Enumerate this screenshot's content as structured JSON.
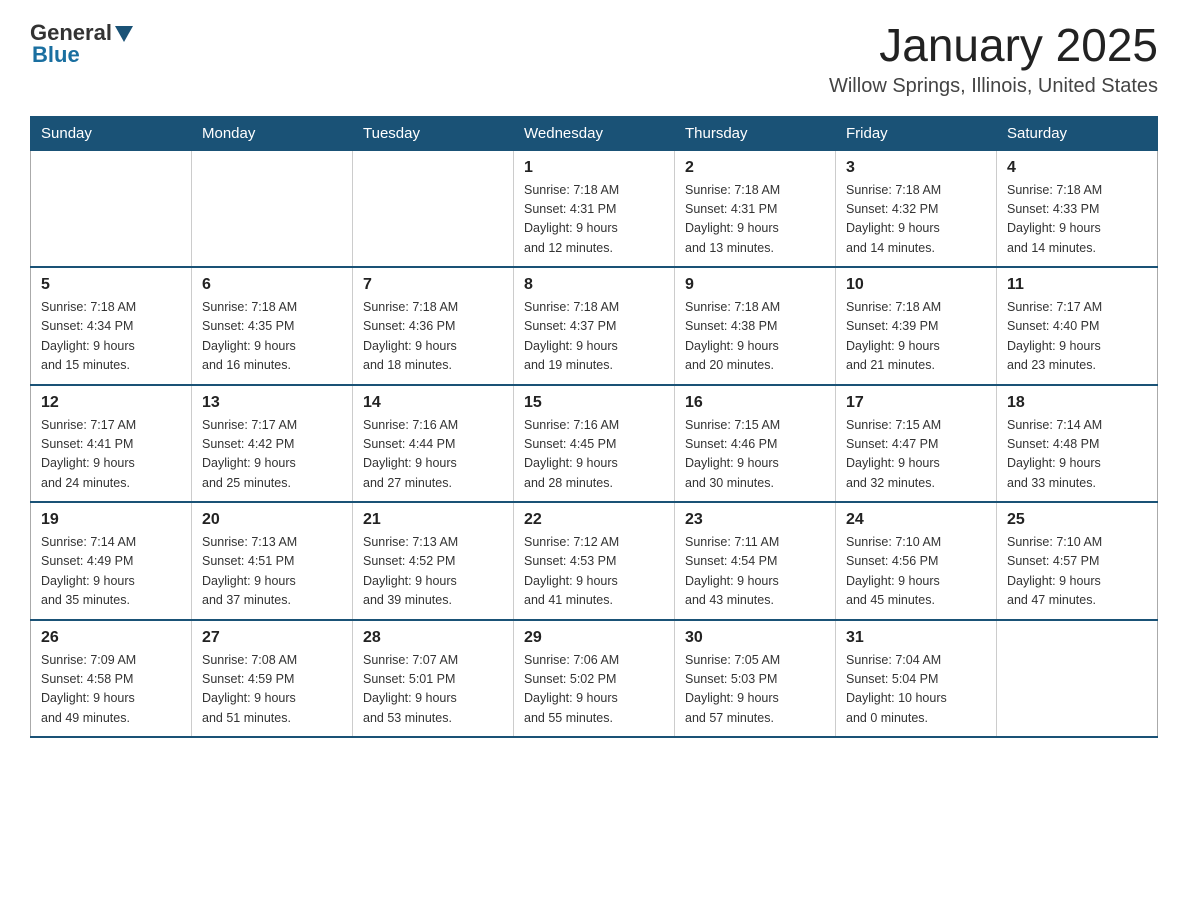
{
  "header": {
    "logo_general": "General",
    "logo_blue": "Blue",
    "title": "January 2025",
    "subtitle": "Willow Springs, Illinois, United States"
  },
  "days_of_week": [
    "Sunday",
    "Monday",
    "Tuesday",
    "Wednesday",
    "Thursday",
    "Friday",
    "Saturday"
  ],
  "weeks": [
    [
      {
        "day": "",
        "info": ""
      },
      {
        "day": "",
        "info": ""
      },
      {
        "day": "",
        "info": ""
      },
      {
        "day": "1",
        "info": "Sunrise: 7:18 AM\nSunset: 4:31 PM\nDaylight: 9 hours\nand 12 minutes."
      },
      {
        "day": "2",
        "info": "Sunrise: 7:18 AM\nSunset: 4:31 PM\nDaylight: 9 hours\nand 13 minutes."
      },
      {
        "day": "3",
        "info": "Sunrise: 7:18 AM\nSunset: 4:32 PM\nDaylight: 9 hours\nand 14 minutes."
      },
      {
        "day": "4",
        "info": "Sunrise: 7:18 AM\nSunset: 4:33 PM\nDaylight: 9 hours\nand 14 minutes."
      }
    ],
    [
      {
        "day": "5",
        "info": "Sunrise: 7:18 AM\nSunset: 4:34 PM\nDaylight: 9 hours\nand 15 minutes."
      },
      {
        "day": "6",
        "info": "Sunrise: 7:18 AM\nSunset: 4:35 PM\nDaylight: 9 hours\nand 16 minutes."
      },
      {
        "day": "7",
        "info": "Sunrise: 7:18 AM\nSunset: 4:36 PM\nDaylight: 9 hours\nand 18 minutes."
      },
      {
        "day": "8",
        "info": "Sunrise: 7:18 AM\nSunset: 4:37 PM\nDaylight: 9 hours\nand 19 minutes."
      },
      {
        "day": "9",
        "info": "Sunrise: 7:18 AM\nSunset: 4:38 PM\nDaylight: 9 hours\nand 20 minutes."
      },
      {
        "day": "10",
        "info": "Sunrise: 7:18 AM\nSunset: 4:39 PM\nDaylight: 9 hours\nand 21 minutes."
      },
      {
        "day": "11",
        "info": "Sunrise: 7:17 AM\nSunset: 4:40 PM\nDaylight: 9 hours\nand 23 minutes."
      }
    ],
    [
      {
        "day": "12",
        "info": "Sunrise: 7:17 AM\nSunset: 4:41 PM\nDaylight: 9 hours\nand 24 minutes."
      },
      {
        "day": "13",
        "info": "Sunrise: 7:17 AM\nSunset: 4:42 PM\nDaylight: 9 hours\nand 25 minutes."
      },
      {
        "day": "14",
        "info": "Sunrise: 7:16 AM\nSunset: 4:44 PM\nDaylight: 9 hours\nand 27 minutes."
      },
      {
        "day": "15",
        "info": "Sunrise: 7:16 AM\nSunset: 4:45 PM\nDaylight: 9 hours\nand 28 minutes."
      },
      {
        "day": "16",
        "info": "Sunrise: 7:15 AM\nSunset: 4:46 PM\nDaylight: 9 hours\nand 30 minutes."
      },
      {
        "day": "17",
        "info": "Sunrise: 7:15 AM\nSunset: 4:47 PM\nDaylight: 9 hours\nand 32 minutes."
      },
      {
        "day": "18",
        "info": "Sunrise: 7:14 AM\nSunset: 4:48 PM\nDaylight: 9 hours\nand 33 minutes."
      }
    ],
    [
      {
        "day": "19",
        "info": "Sunrise: 7:14 AM\nSunset: 4:49 PM\nDaylight: 9 hours\nand 35 minutes."
      },
      {
        "day": "20",
        "info": "Sunrise: 7:13 AM\nSunset: 4:51 PM\nDaylight: 9 hours\nand 37 minutes."
      },
      {
        "day": "21",
        "info": "Sunrise: 7:13 AM\nSunset: 4:52 PM\nDaylight: 9 hours\nand 39 minutes."
      },
      {
        "day": "22",
        "info": "Sunrise: 7:12 AM\nSunset: 4:53 PM\nDaylight: 9 hours\nand 41 minutes."
      },
      {
        "day": "23",
        "info": "Sunrise: 7:11 AM\nSunset: 4:54 PM\nDaylight: 9 hours\nand 43 minutes."
      },
      {
        "day": "24",
        "info": "Sunrise: 7:10 AM\nSunset: 4:56 PM\nDaylight: 9 hours\nand 45 minutes."
      },
      {
        "day": "25",
        "info": "Sunrise: 7:10 AM\nSunset: 4:57 PM\nDaylight: 9 hours\nand 47 minutes."
      }
    ],
    [
      {
        "day": "26",
        "info": "Sunrise: 7:09 AM\nSunset: 4:58 PM\nDaylight: 9 hours\nand 49 minutes."
      },
      {
        "day": "27",
        "info": "Sunrise: 7:08 AM\nSunset: 4:59 PM\nDaylight: 9 hours\nand 51 minutes."
      },
      {
        "day": "28",
        "info": "Sunrise: 7:07 AM\nSunset: 5:01 PM\nDaylight: 9 hours\nand 53 minutes."
      },
      {
        "day": "29",
        "info": "Sunrise: 7:06 AM\nSunset: 5:02 PM\nDaylight: 9 hours\nand 55 minutes."
      },
      {
        "day": "30",
        "info": "Sunrise: 7:05 AM\nSunset: 5:03 PM\nDaylight: 9 hours\nand 57 minutes."
      },
      {
        "day": "31",
        "info": "Sunrise: 7:04 AM\nSunset: 5:04 PM\nDaylight: 10 hours\nand 0 minutes."
      },
      {
        "day": "",
        "info": ""
      }
    ]
  ]
}
